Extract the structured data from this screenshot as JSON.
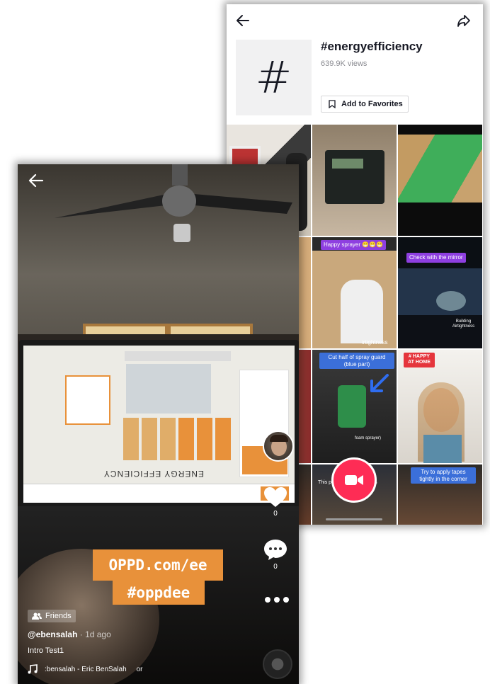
{
  "hashtag_page": {
    "title": "#energyefficiency",
    "views": "639.9K views",
    "favorites_label": "Add to Favorites",
    "hash_symbol": "#",
    "captions": {
      "happy_sprayer": "Happy sprayer 😁😁😁",
      "check_mirror": "Check with the mirror",
      "building_airtightness": "Building Airtightness",
      "airtightness": "irtightness",
      "cut_half": "Cut half of spray guard (blue part)",
      "foam_sprayer": "foam sprayer)",
      "happy_at_home": "# HAPPY AT HOME",
      "try_apply": "Try to apply tapes tightly in the corner",
      "power_station": "This power station outages"
    },
    "colors": {
      "accent": "#fe2c55",
      "caption_purple": "#8e3fe0",
      "caption_blue": "#3b6fd9"
    }
  },
  "video": {
    "promo_line1": "OPPD.com/ee",
    "promo_line2": "#oppdee",
    "website_heading": "ENERGY EFFICIENCY",
    "website_logo": "OPPD",
    "likes": "0",
    "comments": "0",
    "friends_badge": "Friends",
    "username": "@ebensalah",
    "time": "· 1d ago",
    "description": "Intro Test1",
    "music": ":bensalah - Eric BenSalah",
    "music_tail": "or"
  }
}
